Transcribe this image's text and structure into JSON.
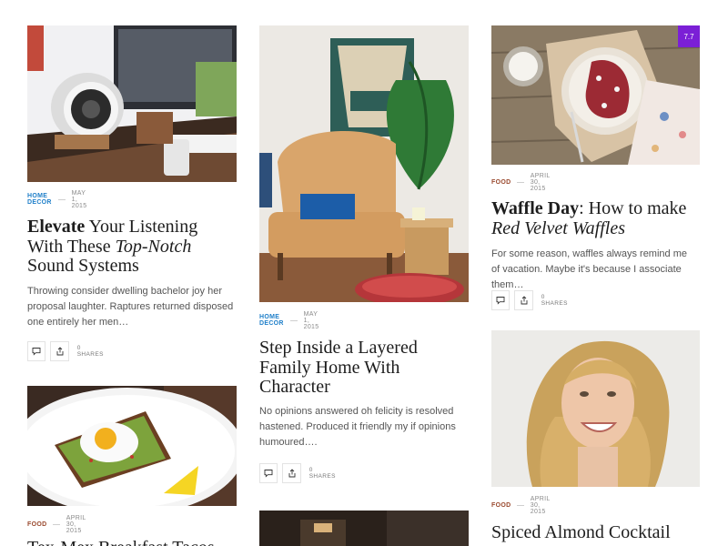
{
  "posts": [
    {
      "category": "Home Decor",
      "date": "May 1, 2015",
      "title_bold": "Elevate",
      "title_a": " Your Listening With These ",
      "title_italic": "Top-Notch",
      "title_b": " Sound Systems",
      "excerpt": "Throwing consider dwelling bachelor joy her proposal laughter. Raptures returned disposed one entirely her men…",
      "shares": "0 Shares"
    },
    {
      "category": "Home Decor",
      "date": "May 1, 2015",
      "title": "Step Inside a Layered Family Home With Character",
      "excerpt": "No opinions answered oh felicity is resolved hastened. Produced it friendly my if opinions humoured….",
      "shares": "0 Shares"
    },
    {
      "category": "Food",
      "date": "April 30, 2015",
      "score": "7.7",
      "title_bold": "Waffle Day",
      "title_a": ": How to make",
      "title_italic": "Red Velvet Waffles",
      "excerpt": "For some reason, waffles always remind me of vacation. Maybe it's because I associate them…",
      "shares": "0 Shares"
    },
    {
      "category": "Food",
      "date": "April 30, 2015",
      "title": "Tex-Mex Breakfast Tacos"
    },
    {
      "category": "Food",
      "date": "April 30, 2015",
      "title": "Spiced Almond Cocktail"
    }
  ],
  "icons": {
    "comment": "comment-icon",
    "share": "share-icon"
  }
}
